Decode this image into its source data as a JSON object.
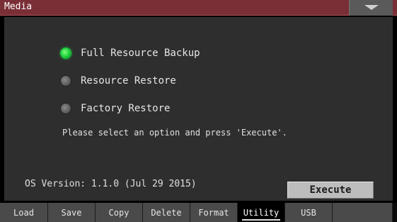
{
  "titlebar": {
    "title": "Media"
  },
  "options": [
    {
      "label": "Full Resource Backup",
      "selected": true
    },
    {
      "label": "Resource Restore",
      "selected": false
    },
    {
      "label": "Factory Restore",
      "selected": false
    }
  ],
  "hint": "Please select an option and press 'Execute'.",
  "os_version": "OS Version: 1.1.0 (Jul 29 2015)",
  "execute_label": "Execute",
  "tabs": [
    {
      "label": "Load",
      "active": false
    },
    {
      "label": "Save",
      "active": false
    },
    {
      "label": "Copy",
      "active": false
    },
    {
      "label": "Delete",
      "active": false
    },
    {
      "label": "Format",
      "active": false
    },
    {
      "label": "Utility",
      "active": true
    },
    {
      "label": "USB",
      "active": false
    }
  ],
  "colors": {
    "titlebar": "#7a2e35",
    "content_bg": "#2e2e2e",
    "radio_selected": "#1fcf3a",
    "tab_bg": "#4a4a4a"
  }
}
